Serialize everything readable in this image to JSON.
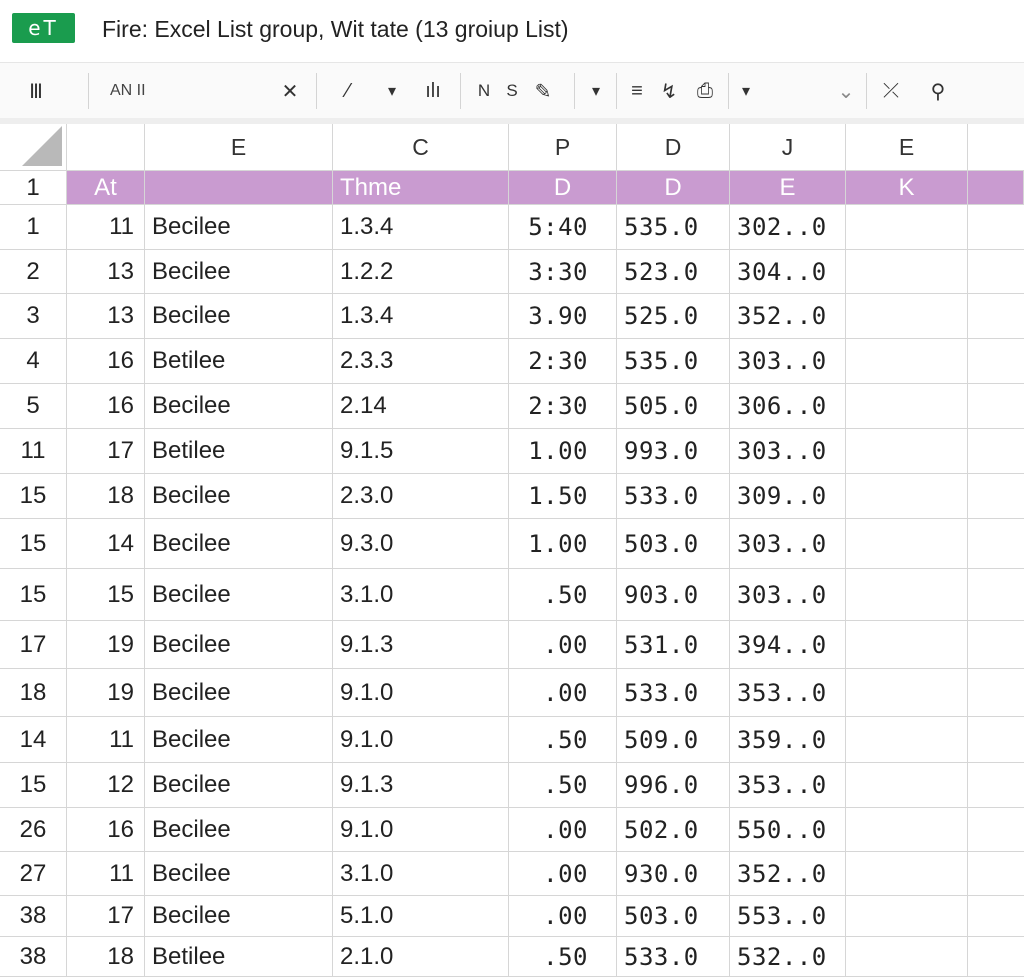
{
  "app": {
    "logo_text": "eT",
    "title": "Fire: Excel List group, Wit tate (13 groiup List)"
  },
  "toolbar": {
    "icon0": "Ⅲ",
    "name_box": "AN II",
    "cancel_glyph": "✕",
    "fx_glyph": "⁄",
    "dropdown1": "▾",
    "chart_glyph": "ılı",
    "bold_label": "N",
    "sub_label": "S",
    "paint_glyph": "✎",
    "dropdown2": "▾",
    "align_glyph": "≡",
    "format_glyph": "↯",
    "print_glyph": "⎙",
    "dropdown3": "▾",
    "chevron": "⌄",
    "tools_glyph": "⤫",
    "search_glyph": "⚲"
  },
  "columns": [
    "",
    "E",
    "C",
    "P",
    "D",
    "J",
    "E"
  ],
  "header_row": {
    "row_num": "1",
    "cells": [
      "At",
      "",
      "Thme",
      "D",
      "D",
      "E",
      "K"
    ]
  },
  "rows": [
    {
      "rn": "1",
      "a": "11",
      "b": "Becilee",
      "c": "1.3.4",
      "d": "5:40",
      "e": "535.0",
      "f": "302..0"
    },
    {
      "rn": "2",
      "a": "13",
      "b": "Becilee",
      "c": "1.2.2",
      "d": "3:30",
      "e": "523.0",
      "f": "304..0"
    },
    {
      "rn": "3",
      "a": "13",
      "b": "Becilee",
      "c": "1.3.4",
      "d": "3.90",
      "e": "525.0",
      "f": "352..0"
    },
    {
      "rn": "4",
      "a": "16",
      "b": "Betilee",
      "c": "2.3.3",
      "d": "2:30",
      "e": "535.0",
      "f": "303..0"
    },
    {
      "rn": "5",
      "a": "16",
      "b": "Becilee",
      "c": "2.14",
      "d": "2:30",
      "e": "505.0",
      "f": "306..0"
    },
    {
      "rn": "11",
      "a": "17",
      "b": "Betilee",
      "c": "9.1.5",
      "d": "1.00",
      "e": "993.0",
      "f": "303..0"
    },
    {
      "rn": "15",
      "a": "18",
      "b": "Becilee",
      "c": "2.3.0",
      "d": "1.50",
      "e": "533.0",
      "f": "309..0"
    },
    {
      "rn": "15",
      "a": "14",
      "b": "Becilee",
      "c": "9.3.0",
      "d": "1.00",
      "e": "503.0",
      "f": "303..0"
    },
    {
      "rn": "15",
      "a": "15",
      "b": "Becilee",
      "c": "3.1.0",
      "d": ".50",
      "e": "903.0",
      "f": "303..0"
    },
    {
      "rn": "17",
      "a": "19",
      "b": "Becilee",
      "c": "9.1.3",
      "d": ".00",
      "e": "531.0",
      "f": "394..0"
    },
    {
      "rn": "18",
      "a": "19",
      "b": "Becilee",
      "c": "9.1.0",
      "d": ".00",
      "e": "533.0",
      "f": "353..0"
    },
    {
      "rn": "14",
      "a": "11",
      "b": "Becilee",
      "c": "9.1.0",
      "d": ".50",
      "e": "509.0",
      "f": "359..0"
    },
    {
      "rn": "15",
      "a": "12",
      "b": "Becilee",
      "c": "9.1.3",
      "d": ".50",
      "e": "996.0",
      "f": "353..0"
    },
    {
      "rn": "26",
      "a": "16",
      "b": "Becilee",
      "c": "9.1.0",
      "d": ".00",
      "e": "502.0",
      "f": "550..0"
    },
    {
      "rn": "27",
      "a": "11",
      "b": "Becilee",
      "c": "3.1.0",
      "d": ".00",
      "e": "930.0",
      "f": "352..0"
    },
    {
      "rn": "38",
      "a": "17",
      "b": "Becilee",
      "c": "5.1.0",
      "d": ".00",
      "e": "503.0",
      "f": "553..0"
    },
    {
      "rn": "38",
      "a": "18",
      "b": "Betilee",
      "c": "2.1.0",
      "d": ".50",
      "e": "533.0",
      "f": "532..0"
    }
  ],
  "colors": {
    "header_fill": "#c99bd0",
    "logo_green": "#1a9c4e"
  }
}
